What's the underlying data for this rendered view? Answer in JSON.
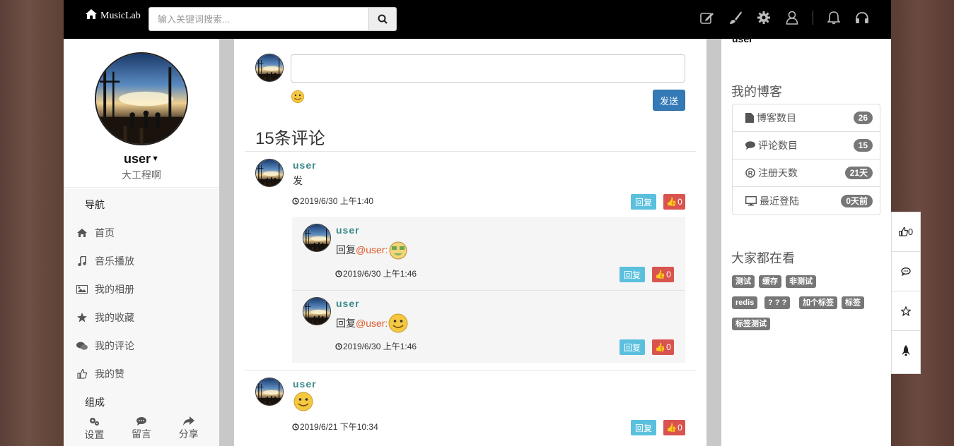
{
  "app": {
    "title": "MusicLab"
  },
  "search": {
    "placeholder": "输入关键词搜索..."
  },
  "topbar": {
    "icons": [
      "edit-icon",
      "brush-icon",
      "gear-icon",
      "user-icon",
      "bell-icon",
      "headphones-icon"
    ]
  },
  "profile": {
    "name": "user",
    "signature": "大工程啊"
  },
  "nav": {
    "section1": "导航",
    "items": [
      {
        "label": "首页",
        "icon": "home-icon"
      },
      {
        "label": "音乐播放",
        "icon": "music-icon"
      },
      {
        "label": "我的相册",
        "icon": "picture-icon"
      },
      {
        "label": "我的收藏",
        "icon": "star-icon"
      },
      {
        "label": "我的评论",
        "icon": "comments-icon"
      },
      {
        "label": "我的赞",
        "icon": "thumbs-up-icon"
      }
    ],
    "section2": "组成"
  },
  "bottombar": [
    {
      "label": "设置",
      "icon": "cogs-icon"
    },
    {
      "label": "留言",
      "icon": "comment-icon"
    },
    {
      "label": "分享",
      "icon": "share-icon"
    }
  ],
  "composer": {
    "send_label": "发送"
  },
  "comments_header": "15条评论",
  "comments": [
    {
      "user": "user",
      "text": "发",
      "time": "2019/6/30 上午1:40",
      "reply_label": "回复",
      "likes": "0",
      "replies": [
        {
          "user": "user",
          "prefix": "回复",
          "mention": "@user:",
          "emoji": "money-face",
          "time": "2019/6/30 上午1:46",
          "reply_label": "回复",
          "likes": "0"
        },
        {
          "user": "user",
          "prefix": "回复",
          "mention": "@user:",
          "emoji": "smile-face",
          "time": "2019/6/30 上午1:46",
          "reply_label": "回复",
          "likes": "0"
        }
      ]
    },
    {
      "user": "user",
      "text": "",
      "emoji": "smile-face",
      "time": "2019/6/21 下午10:34",
      "reply_label": "回复",
      "likes": "0"
    }
  ],
  "right": {
    "cut_text": "user",
    "blog_title": "我的博客",
    "stats": [
      {
        "label": "博客数目",
        "icon": "file-icon",
        "value": "26"
      },
      {
        "label": "评论数目",
        "icon": "comment-icon",
        "value": "15"
      },
      {
        "label": "注册天数",
        "icon": "registered-icon",
        "value": "21天"
      },
      {
        "label": "最近登陆",
        "icon": "monitor-icon",
        "value": "0天前"
      }
    ],
    "hot_title": "大家都在看",
    "tags": [
      "测试",
      "缓存",
      "非测试",
      "redis",
      "? ? ?",
      "加个标签",
      "标签",
      "标签测试"
    ]
  },
  "floatbar": {
    "like_count": "0",
    "icons": [
      "thumbs-up-icon",
      "comment-icon",
      "star-icon",
      "rocket-icon"
    ]
  },
  "colors": {
    "topbar": "#000000",
    "primary": "#337ab7",
    "reply": "#5bc0de",
    "like": "#d9534f",
    "username": "#3b8a8a",
    "mention": "#e05a2b",
    "badge": "#777777"
  }
}
